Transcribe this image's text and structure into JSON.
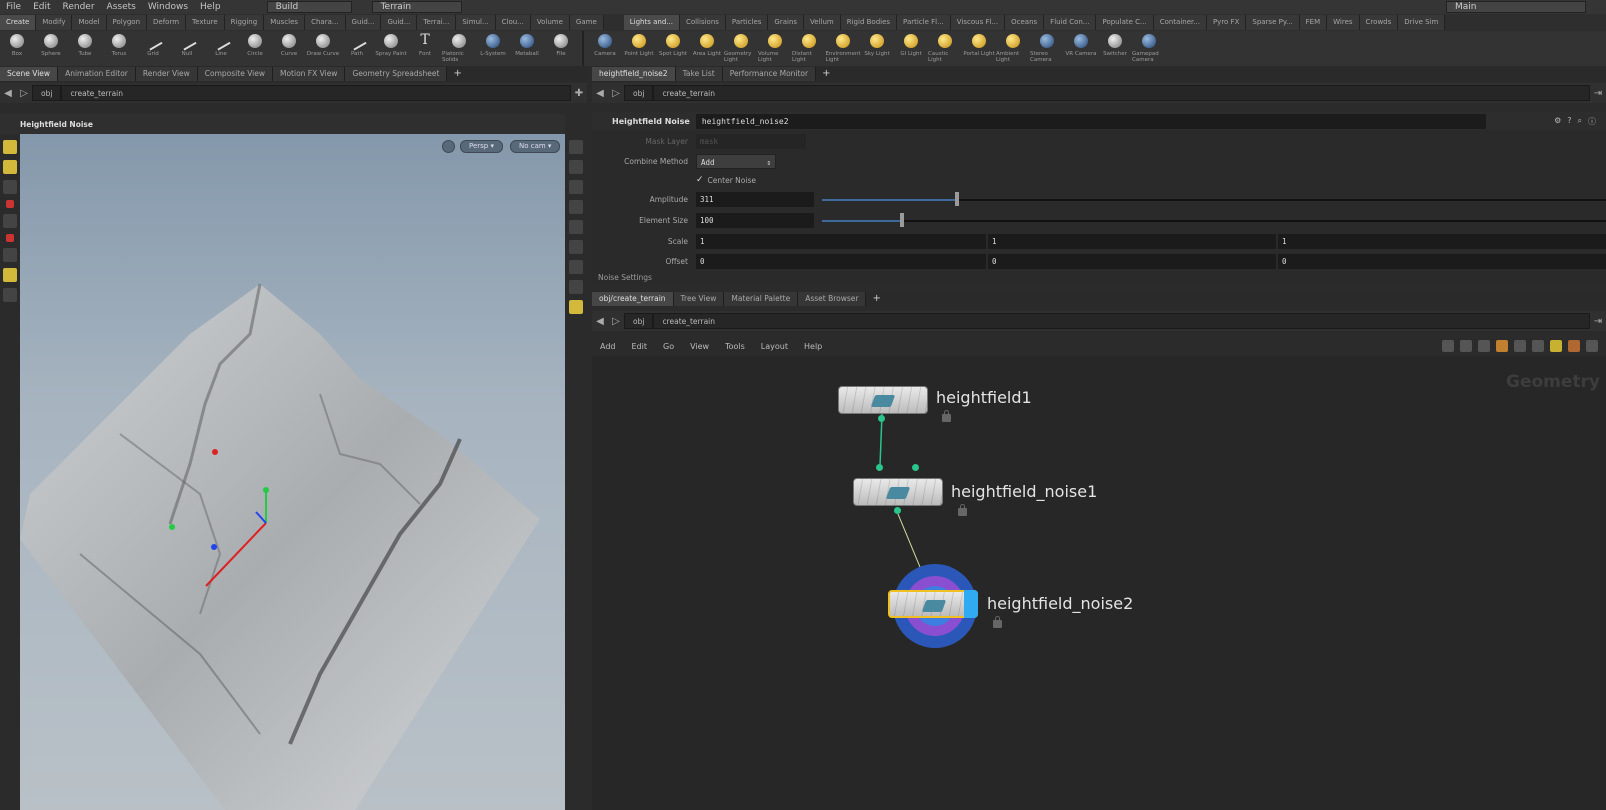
{
  "menu": {
    "items": [
      "File",
      "Edit",
      "Render",
      "Assets",
      "Windows",
      "Help"
    ],
    "desktop": "Build",
    "context": "Terrain",
    "right_select": "Main"
  },
  "shelf_tabs_left": [
    "Create",
    "Modify",
    "Model",
    "Polygon",
    "Deform",
    "Texture",
    "Rigging",
    "Muscles",
    "Chara...",
    "Guid...",
    "Guid...",
    "Terrai...",
    "Simul...",
    "Clou...",
    "Volume",
    "Game"
  ],
  "shelf_tabs_right": [
    "Lights and...",
    "Collisions",
    "Particles",
    "Grains",
    "Vellum",
    "Rigid Bodies",
    "Particle Fl...",
    "Viscous Fl...",
    "Oceans",
    "Fluid Con...",
    "Populate C...",
    "Container...",
    "Pyro FX",
    "Sparse Py...",
    "FEM",
    "Wires",
    "Crowds",
    "Drive Sim"
  ],
  "shelf_tools_left": [
    {
      "label": "Box",
      "icon": "box-icon"
    },
    {
      "label": "Sphere",
      "icon": "sphere-icon"
    },
    {
      "label": "Tube",
      "icon": "tube-icon"
    },
    {
      "label": "Torus",
      "icon": "torus-icon"
    },
    {
      "label": "Grid",
      "icon": "grid-icon"
    },
    {
      "label": "Null",
      "icon": "null-icon"
    },
    {
      "label": "Line",
      "icon": "line-icon"
    },
    {
      "label": "Circle",
      "icon": "circle-icon"
    },
    {
      "label": "Curve",
      "icon": "curve-icon"
    },
    {
      "label": "Draw Curve",
      "icon": "draw-curve-icon"
    },
    {
      "label": "Path",
      "icon": "path-icon"
    },
    {
      "label": "Spray Paint",
      "icon": "spray-paint-icon"
    },
    {
      "label": "Font",
      "icon": "font-icon"
    },
    {
      "label": "Platonic Solids",
      "icon": "platonic-icon"
    },
    {
      "label": "L-System",
      "icon": "lsystem-icon"
    },
    {
      "label": "Metaball",
      "icon": "metaball-icon"
    },
    {
      "label": "File",
      "icon": "file-icon"
    }
  ],
  "shelf_tools_right": [
    {
      "label": "Camera",
      "icon": "camera-icon"
    },
    {
      "label": "Point Light",
      "icon": "point-light-icon"
    },
    {
      "label": "Spot Light",
      "icon": "spot-light-icon"
    },
    {
      "label": "Area Light",
      "icon": "area-light-icon"
    },
    {
      "label": "Geometry Light",
      "icon": "geometry-light-icon"
    },
    {
      "label": "Volume Light",
      "icon": "volume-light-icon"
    },
    {
      "label": "Distant Light",
      "icon": "distant-light-icon"
    },
    {
      "label": "Environment Light",
      "icon": "environment-light-icon"
    },
    {
      "label": "Sky Light",
      "icon": "sky-light-icon"
    },
    {
      "label": "GI Light",
      "icon": "gi-light-icon"
    },
    {
      "label": "Caustic Light",
      "icon": "caustic-light-icon"
    },
    {
      "label": "Portal Light",
      "icon": "portal-light-icon"
    },
    {
      "label": "Ambient Light",
      "icon": "ambient-light-icon"
    },
    {
      "label": "Stereo Camera",
      "icon": "stereo-camera-icon"
    },
    {
      "label": "VR Camera",
      "icon": "vr-camera-icon"
    },
    {
      "label": "Switcher",
      "icon": "switcher-icon"
    },
    {
      "label": "Gamepad Camera",
      "icon": "gamepad-camera-icon"
    }
  ],
  "left_pane": {
    "tabs": [
      "Scene View",
      "Animation Editor",
      "Render View",
      "Composite View",
      "Motion FX View",
      "Geometry Spreadsheet"
    ],
    "path_root": "obj",
    "path_node": "create_terrain",
    "viewport_title": "Heightfield Noise",
    "persp_label": "Persp",
    "cam_label": "No cam"
  },
  "param_pane": {
    "tabs": [
      "heightfield_noise2",
      "Take List",
      "Performance Monitor"
    ],
    "path_root": "obj",
    "path_node": "create_terrain",
    "node_type": "Heightfield Noise",
    "node_name": "heightfield_noise2",
    "rows": {
      "mask_layer": {
        "label": "Mask Layer",
        "value": "mask"
      },
      "combine": {
        "label": "Combine Method",
        "value": "Add"
      },
      "center_noise": {
        "label": "Center Noise"
      },
      "amplitude": {
        "label": "Amplitude",
        "value": "311",
        "slider": 0.17
      },
      "element_size": {
        "label": "Element Size",
        "value": "100",
        "slider": 0.1
      },
      "scale": {
        "label": "Scale",
        "values": [
          "1",
          "1",
          "1"
        ]
      },
      "offset": {
        "label": "Offset",
        "values": [
          "0",
          "0",
          "0"
        ]
      }
    },
    "section": "Noise Settings"
  },
  "network": {
    "tabs": [
      "obj/create_terrain",
      "Tree View",
      "Material Palette",
      "Asset Browser"
    ],
    "path_root": "obj",
    "path_node": "create_terrain",
    "menu": [
      "Add",
      "Edit",
      "Go",
      "View",
      "Tools",
      "Layout",
      "Help"
    ],
    "watermark": "Geometry",
    "nodes": [
      {
        "name": "heightfield1"
      },
      {
        "name": "heightfield_noise1"
      },
      {
        "name": "heightfield_noise2"
      }
    ]
  },
  "colors": {
    "accent": "#d2b93b",
    "wire": "#29c58a",
    "selected_ring": "#2b58b8"
  }
}
